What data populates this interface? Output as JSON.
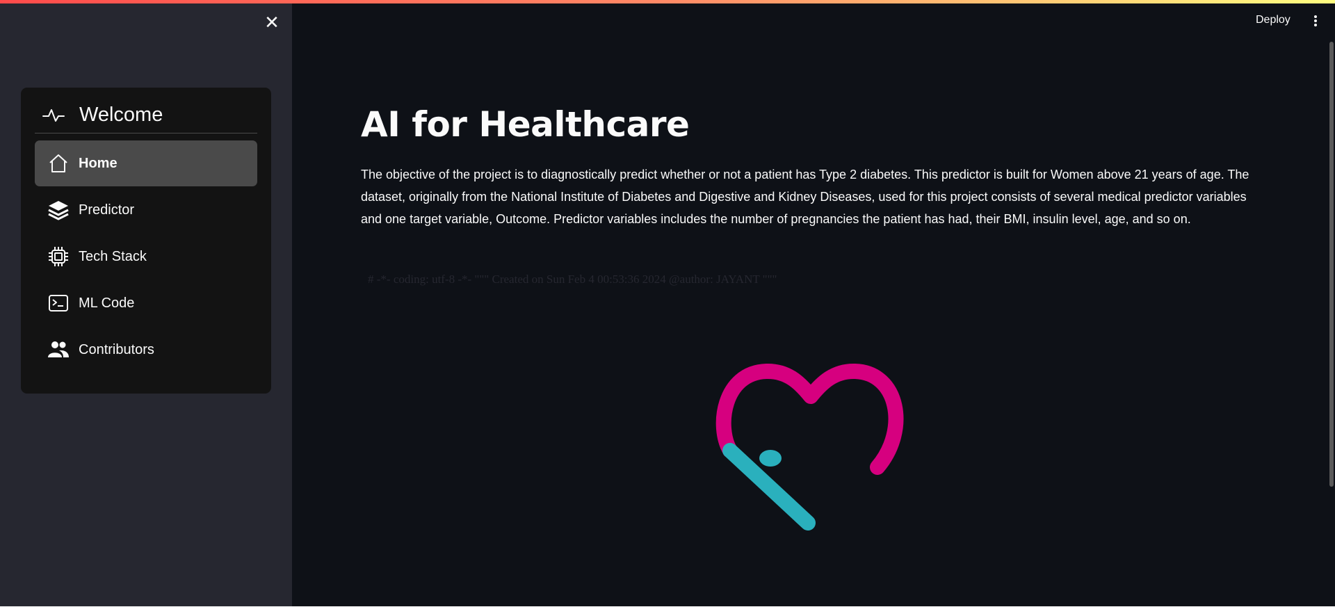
{
  "sidebar": {
    "close_icon": "close-icon",
    "menu": {
      "title": "Welcome",
      "title_icon": "activity-icon",
      "items": [
        {
          "label": "Home",
          "icon": "house-icon",
          "active": true
        },
        {
          "label": "Predictor",
          "icon": "layers-icon",
          "active": false
        },
        {
          "label": "Tech Stack",
          "icon": "cpu-icon",
          "active": false
        },
        {
          "label": "ML Code",
          "icon": "terminal-icon",
          "active": false
        },
        {
          "label": "Contributors",
          "icon": "people-icon",
          "active": false
        }
      ]
    }
  },
  "toolbar": {
    "deploy_label": "Deploy",
    "menu_icon": "kebab-menu-icon"
  },
  "main": {
    "title": "AI for Healthcare",
    "intro": "The objective of the project is to diagnostically predict whether or not a patient has Type 2 diabetes. This predictor is built for Women above 21 years of age. The dataset, originally from the National Institute of Diabetes and Digestive and Kidney Diseases, used for this project consists of several medical predictor variables and one target variable, Outcome. Predictor variables includes the number of pregnancies the patient has had, their BMI, insulin level, age, and so on.",
    "code_comment": "# -*- coding: utf-8 -*- \"\"\" Created on Sun Feb 4 00:53:36 2024 @author: JAYANT \"\"\"",
    "logo_icon": "heart-health-logo"
  },
  "colors": {
    "sidebar_bg": "#262730",
    "main_bg": "#0e1117",
    "menu_bg": "#131313",
    "active_item_bg": "#4a4a4a",
    "heart_pink": "#d6007f",
    "heart_teal": "#2ab0bd"
  }
}
